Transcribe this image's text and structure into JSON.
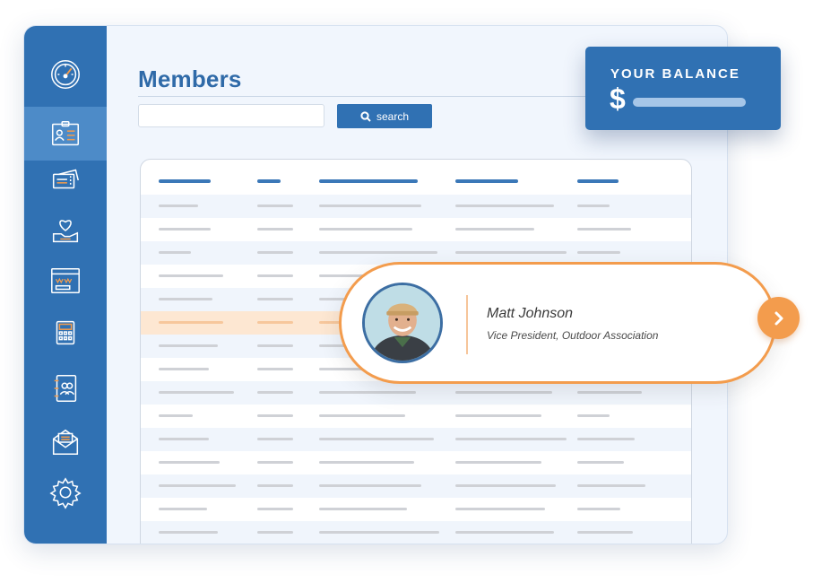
{
  "page": {
    "title": "Members"
  },
  "search": {
    "placeholder": "",
    "button_label": "search"
  },
  "sidebar": {
    "items": [
      {
        "name": "dashboard",
        "icon": "speedometer-icon"
      },
      {
        "name": "members",
        "icon": "member-card-icon",
        "active": true
      },
      {
        "name": "tickets",
        "icon": "tickets-icon"
      },
      {
        "name": "donations",
        "icon": "heart-hand-icon"
      },
      {
        "name": "website",
        "icon": "browser-window-icon"
      },
      {
        "name": "accounting",
        "icon": "calculator-icon"
      },
      {
        "name": "directory",
        "icon": "contact-book-icon"
      },
      {
        "name": "email",
        "icon": "mail-icon"
      },
      {
        "name": "settings",
        "icon": "gear-icon"
      }
    ]
  },
  "balance": {
    "label": "YOUR BALANCE",
    "currency": "$"
  },
  "profile": {
    "name": "Matt Johnson",
    "role": "Vice President, Outdoor Association"
  },
  "table": {
    "row_count": 15,
    "highlighted_row": 5
  },
  "colors": {
    "primary": "#3071b3",
    "accent": "#f39c4d",
    "highlight": "#fde7d2"
  }
}
